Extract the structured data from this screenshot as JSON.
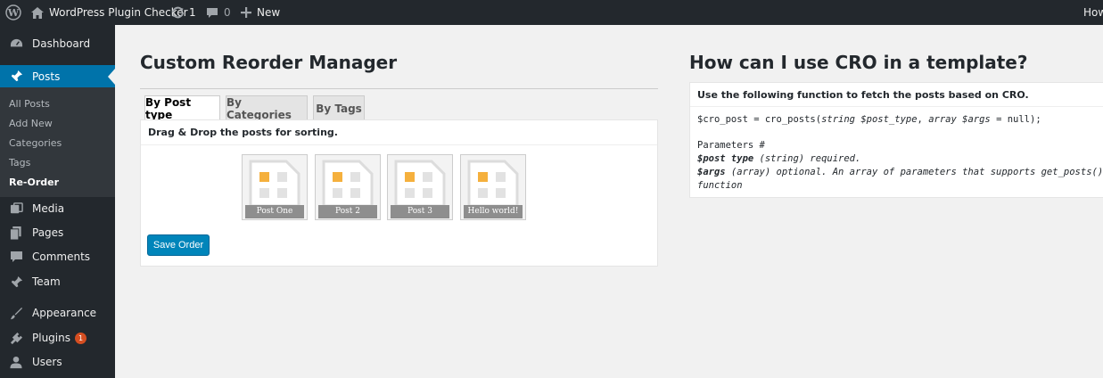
{
  "adminbar": {
    "site_name": "WordPress Plugin Checker",
    "updates_count": "1",
    "comments_count": "0",
    "new_label": "New",
    "howdy_label": "How"
  },
  "sidebar": {
    "dashboard": "Dashboard",
    "posts": "Posts",
    "sub": [
      "All Posts",
      "Add New",
      "Categories",
      "Tags",
      "Re-Order"
    ],
    "media": "Media",
    "pages": "Pages",
    "comments": "Comments",
    "team": "Team",
    "appearance": "Appearance",
    "plugins": "Plugins",
    "plugins_badge": "1",
    "users": "Users"
  },
  "left": {
    "title": "Custom Reorder Manager",
    "tabs": [
      "By Post type",
      "By Categories",
      "By Tags"
    ],
    "instructions": "Drag & Drop the posts for sorting.",
    "posts": [
      "Post One",
      "Post 2",
      "Post 3",
      "Hello world!"
    ],
    "save_label": "Save Order"
  },
  "right": {
    "title": "How can I use CRO in a template?",
    "header": "Use the following function to fetch the posts based on CRO.",
    "code": {
      "prefix": " $cro_post = cro_posts(",
      "arg1": "string $post_type",
      "sep": ", ",
      "arg2": "array $args",
      "suffix": " = null);",
      "params_heading": "Parameters #",
      "p1_name": "$post type",
      "p1_desc": " (string) required.",
      "p2_name": "$args",
      "p2_desc": " (array) optional. An array of parameters that supports get_posts()",
      "p2_desc_cont": "function"
    }
  },
  "colors": {
    "adminbar_bg": "#23282d",
    "accent": "#0073aa",
    "button": "#0085ba",
    "badge": "#d54e21",
    "thumb_accent": "#f5b03d"
  },
  "icons": [
    "wordpress-icon",
    "home-icon",
    "updates-icon",
    "comment-icon",
    "plus-icon",
    "dashboard-icon",
    "pin-icon",
    "media-icon",
    "pages-icon",
    "comments-icon",
    "appearance-icon",
    "plugins-icon",
    "users-icon"
  ]
}
